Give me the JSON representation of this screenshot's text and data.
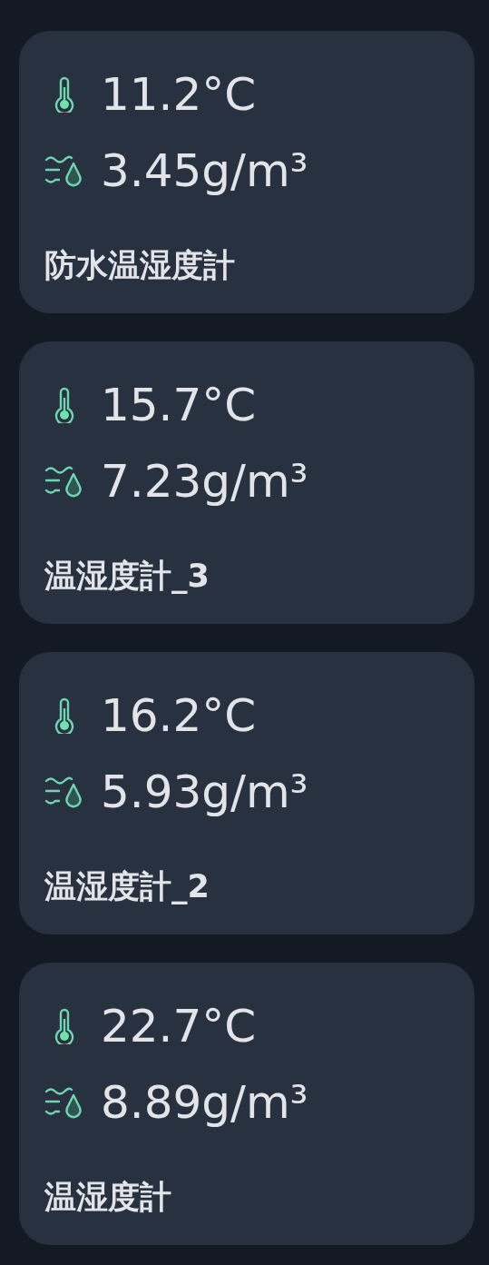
{
  "sensors": [
    {
      "temperature": "11.2°C",
      "humidity": "3.45g/m³",
      "name": "防水温湿度計"
    },
    {
      "temperature": "15.7°C",
      "humidity": "7.23g/m³",
      "name": "温湿度計_3"
    },
    {
      "temperature": "16.2°C",
      "humidity": "5.93g/m³",
      "name": "温湿度計_2"
    },
    {
      "temperature": "22.7°C",
      "humidity": "8.89g/m³",
      "name": "温湿度計"
    }
  ]
}
